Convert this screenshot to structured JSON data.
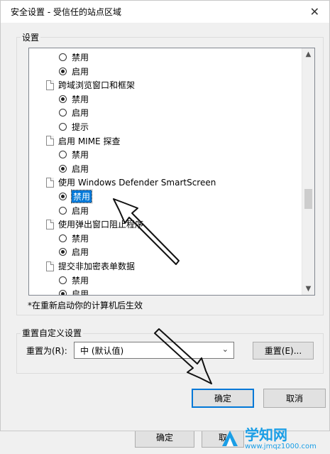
{
  "dialog": {
    "title": "安全设置 - 受信任的站点区域",
    "close_label": "✕"
  },
  "settings": {
    "group_label": "设置",
    "rows": [
      {
        "kind": "radio",
        "label": "禁用",
        "checked": false,
        "indent": 2,
        "selected": false
      },
      {
        "kind": "radio",
        "label": "启用",
        "checked": true,
        "indent": 2,
        "selected": false
      },
      {
        "kind": "heading",
        "label": "跨域浏览窗口和框架",
        "indent": 1
      },
      {
        "kind": "radio",
        "label": "禁用",
        "checked": true,
        "indent": 2,
        "selected": false
      },
      {
        "kind": "radio",
        "label": "启用",
        "checked": false,
        "indent": 2,
        "selected": false
      },
      {
        "kind": "radio",
        "label": "提示",
        "checked": false,
        "indent": 2,
        "selected": false
      },
      {
        "kind": "heading",
        "label": "启用 MIME 探查",
        "indent": 1
      },
      {
        "kind": "radio",
        "label": "禁用",
        "checked": false,
        "indent": 2,
        "selected": false
      },
      {
        "kind": "radio",
        "label": "启用",
        "checked": true,
        "indent": 2,
        "selected": false
      },
      {
        "kind": "heading",
        "label": "使用 Windows Defender SmartScreen",
        "indent": 1
      },
      {
        "kind": "radio",
        "label": "禁用",
        "checked": true,
        "indent": 2,
        "selected": true
      },
      {
        "kind": "radio",
        "label": "启用",
        "checked": false,
        "indent": 2,
        "selected": false
      },
      {
        "kind": "heading",
        "label": "使用弹出窗口阻止程序",
        "indent": 1
      },
      {
        "kind": "radio",
        "label": "禁用",
        "checked": false,
        "indent": 2,
        "selected": false
      },
      {
        "kind": "radio",
        "label": "启用",
        "checked": true,
        "indent": 2,
        "selected": false
      },
      {
        "kind": "heading",
        "label": "提交非加密表单数据",
        "indent": 1
      },
      {
        "kind": "radio",
        "label": "禁用",
        "checked": false,
        "indent": 2,
        "selected": false
      },
      {
        "kind": "radio",
        "label": "启用",
        "checked": true,
        "indent": 2,
        "selected": false
      }
    ],
    "note": "*在重新启动你的计算机后生效"
  },
  "reset": {
    "group_label": "重置自定义设置",
    "reset_to_label": "重置为(R):",
    "select_value": "中 (默认值)",
    "reset_button": "重置(E)..."
  },
  "buttons": {
    "ok": "确定",
    "cancel": "取消"
  },
  "background_buttons": {
    "ok": "确定",
    "partial": "取"
  },
  "watermark": {
    "big": "学知网",
    "small": "www.jmqz1000.com"
  },
  "colors": {
    "accent": "#0078d7",
    "annotation": "#111111"
  }
}
